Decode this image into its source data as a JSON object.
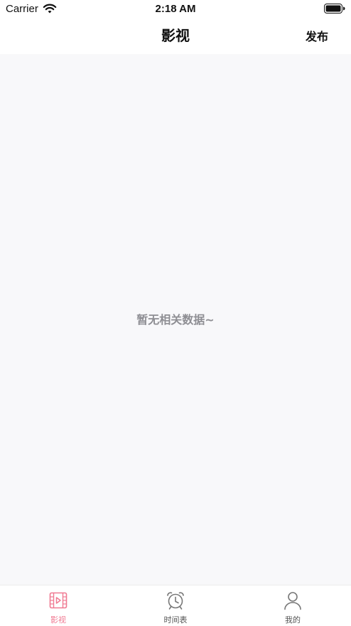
{
  "status_bar": {
    "carrier": "Carrier",
    "time": "2:18 AM"
  },
  "nav": {
    "title": "影视",
    "publish_label": "发布"
  },
  "content": {
    "empty_text": "暂无相关数据~"
  },
  "tabs": [
    {
      "label": "影视",
      "icon": "film-icon",
      "active": true
    },
    {
      "label": "时间表",
      "icon": "alarm-clock-icon",
      "active": false
    },
    {
      "label": "我的",
      "icon": "person-icon",
      "active": false
    }
  ],
  "colors": {
    "accent": "#f07a92",
    "background": "#f8f8fa",
    "inactive": "#555555",
    "empty_text": "#8e8e93"
  }
}
